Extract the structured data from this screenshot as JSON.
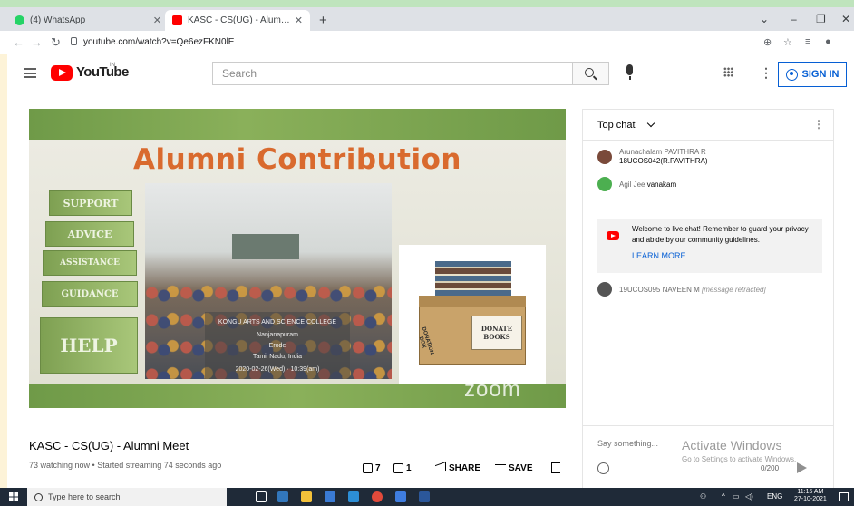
{
  "browser": {
    "tabs": [
      {
        "label": "(4) WhatsApp",
        "favicon_color": "#25d366"
      },
      {
        "label": "KASC - CS(UG) - Alumni Meet - YouTube",
        "favicon_color": "#ff0000"
      }
    ],
    "url": "youtube.com/watch?v=Qe6ezFKN0lE",
    "new_tab": "+",
    "win_controls": {
      "chevron": "⌄",
      "minimize": "–",
      "restore": "❐",
      "close": "✕"
    }
  },
  "youtube": {
    "logo_text": "YouTube",
    "country_code": "IN",
    "search_placeholder": "Search",
    "sign_in": "SIGN IN"
  },
  "video": {
    "slide_title": "Alumni Contribution",
    "blocks": [
      "SUPPORT",
      "ADVICE",
      "ASSISTANCE",
      "GUIDANCE",
      "HELP"
    ],
    "caption_lines": [
      "KONGU ARTS AND SCIENCE COLLEGE",
      "Nanjanapuram",
      "Erode",
      "Tamil Nadu, India",
      "2020-02-26(Wed) · 10:39(am)"
    ],
    "donation_label": "DONATION BOX",
    "donate_sign": "DONATE\nBOOKS",
    "watermark": "zoom",
    "title": "KASC - CS(UG) - Alumni Meet",
    "meta": "73 watching now • Started streaming 74 seconds ago",
    "likes": "7",
    "dislikes": "1",
    "share_label": "SHARE",
    "save_label": "SAVE"
  },
  "chat": {
    "header": "Top chat",
    "messages": [
      {
        "author": "Arunachalam PAVITHRA R",
        "text": "18UCOS042(R.PAVITHRA)",
        "avatar_color": "#7a4a3a"
      },
      {
        "author": "Agil Jee",
        "text": "vanakam",
        "avatar_color": "#4caf50"
      },
      {
        "author": "19UCOS095 NAVEEN M",
        "text": "[message retracted]",
        "avatar_color": "#555555"
      }
    ],
    "banner_text": "Welcome to live chat! Remember to guard your privacy and abide by our community guidelines.",
    "learn_more": "LEARN MORE",
    "input_placeholder": "Say something...",
    "counter": "0/200"
  },
  "watermark": {
    "line1": "Activate Windows",
    "line2": "Go to Settings to activate Windows."
  },
  "taskbar": {
    "search_text": "Type here to search",
    "time": "11:15 AM",
    "date": "27-10-2021",
    "lang": "ENG"
  }
}
